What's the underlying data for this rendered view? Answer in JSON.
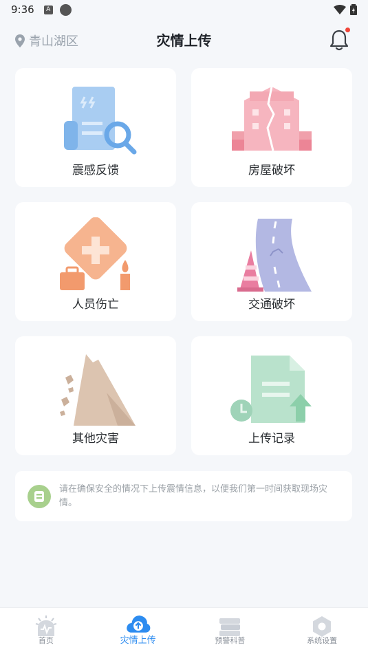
{
  "status_bar": {
    "time": "9:36",
    "a_badge": "A"
  },
  "header": {
    "location": "青山湖区",
    "title": "灾情上传"
  },
  "cards": [
    {
      "label": "震感反馈",
      "icon": "document-search-icon"
    },
    {
      "label": "房屋破坏",
      "icon": "cracked-building-icon"
    },
    {
      "label": "人员伤亡",
      "icon": "first-aid-icon"
    },
    {
      "label": "交通破坏",
      "icon": "damaged-road-icon"
    },
    {
      "label": "其他灾害",
      "icon": "landslide-icon"
    },
    {
      "label": "上传记录",
      "icon": "upload-record-icon"
    }
  ],
  "notice": {
    "text": "请在确保安全的情况下上传震情信息，以便我们第一时间获取现场灾情。"
  },
  "tabbar": {
    "items": [
      {
        "label": "首页",
        "icon": "alarm-icon",
        "active": false
      },
      {
        "label": "灾情上传",
        "icon": "cloud-upload-icon",
        "active": true
      },
      {
        "label": "预警科普",
        "icon": "books-icon",
        "active": false
      },
      {
        "label": "系统设置",
        "icon": "settings-icon",
        "active": false
      }
    ]
  },
  "colors": {
    "accent": "#2d8cf0",
    "background": "#f5f7fa",
    "badge": "#f04438"
  }
}
